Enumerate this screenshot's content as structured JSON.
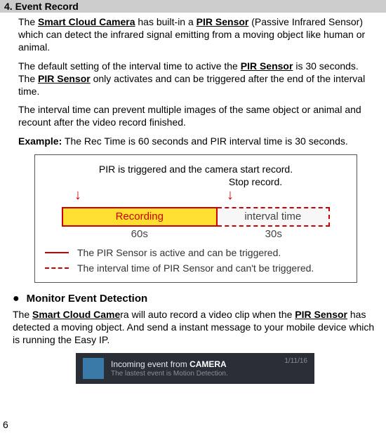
{
  "section": {
    "title": "4. Event Record"
  },
  "p1": {
    "a": "The ",
    "b": "Smart Cloud Camera",
    "c": " has built-in a ",
    "d": "PIR Sensor",
    "e": " (Passive Infrared Sensor) which can detect the infrared signal emitting from a moving object like human or animal."
  },
  "p2": {
    "a": "The default setting of the interval time to active the ",
    "b": "PIR Sensor",
    "c": " is 30 seconds. The ",
    "d": "PIR Sensor",
    "e": " only activates and can be triggered after the end of the interval time."
  },
  "p3": "The interval time can prevent multiple images of the same object or animal and recount after the video record finished.",
  "p4": {
    "a": "Example:",
    "b": " The Rec Time is 60 seconds and PIR interval time is 30 seconds."
  },
  "diagram": {
    "trigger": "PIR is triggered and the camera start record.",
    "stop": "Stop record.",
    "recording": "Recording",
    "interval": "interval time",
    "t60": "60s",
    "t30": "30s",
    "legend1": "The PIR Sensor is active and can be triggered.",
    "legend2": "The interval time of PIR Sensor and can't be triggered."
  },
  "bullet": {
    "dot": "●",
    "text": "Monitor Event Detection"
  },
  "p5": {
    "a": "The ",
    "b": "Smart Cloud Came",
    "c": "ra will auto record a video clip when the ",
    "d": "PIR Sensor",
    "e": " has detected a moving object. And send a instant message to your mobile device which is running the Easy IP."
  },
  "notif": {
    "title_a": "Incoming event from ",
    "title_b": "CAMERA",
    "sub": "The lastest event is Motion Detection.",
    "time": "1/11/16"
  },
  "page": "6"
}
